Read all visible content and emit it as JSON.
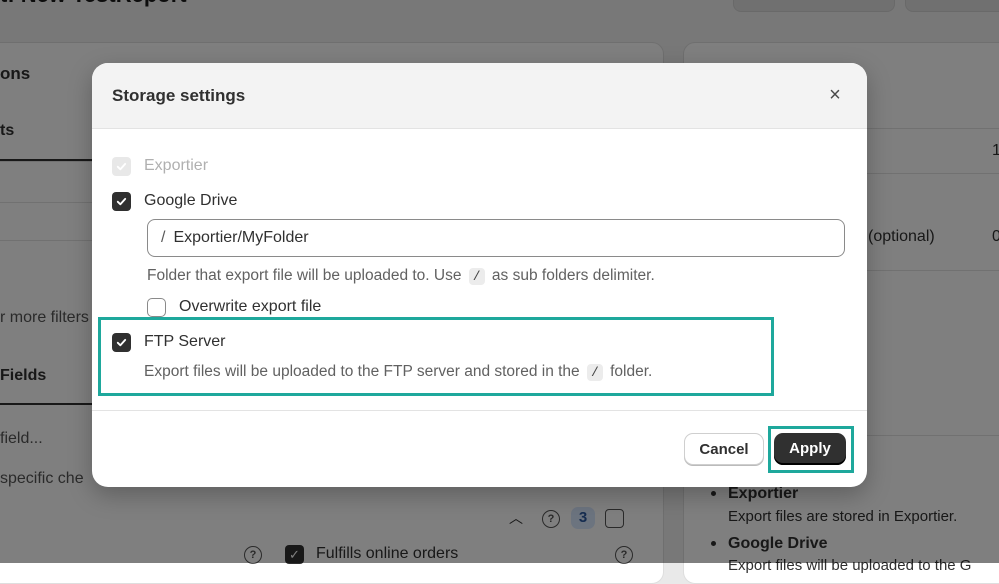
{
  "background": {
    "page_title": "t: New TestReport",
    "left_card": {
      "section_heading": "ons",
      "tab_label": "ts",
      "more_filters": "r more filters",
      "fields_heading": "Fields",
      "field_search_placeholder": "field...",
      "specific_text": "specific che",
      "count_badge": "3",
      "fulfills_label": "Fulfills online orders"
    },
    "right_card": {
      "optional_label": "(optional)",
      "value_1": "1",
      "value_0": "0",
      "exportier_title": "Exportier",
      "exportier_desc": "Export files are stored in Exportier.",
      "google_drive_title": "Google Drive",
      "google_drive_desc": "Export files will be uploaded to the G"
    }
  },
  "modal": {
    "title": "Storage settings",
    "close_icon": "close-icon",
    "options": {
      "exportier": {
        "label": "Exportier",
        "checked": true,
        "disabled": true
      },
      "google_drive": {
        "label": "Google Drive",
        "checked": true
      },
      "ftp_server": {
        "label": "FTP Server",
        "checked": true
      }
    },
    "folder_input": {
      "prefix": "/",
      "value": "Exportier/MyFolder"
    },
    "folder_help_before": "Folder that export file will be uploaded to. Use",
    "folder_help_code": "/",
    "folder_help_after": "as sub folders delimiter.",
    "overwrite_label": "Overwrite export file",
    "overwrite_checked": false,
    "ftp_help_before": "Export files will be uploaded to the FTP server and stored in the",
    "ftp_help_code": "/",
    "ftp_help_after": "folder.",
    "cancel_label": "Cancel",
    "apply_label": "Apply"
  },
  "colors": {
    "highlight": "#1ea89c",
    "primary_button": "#303030"
  }
}
